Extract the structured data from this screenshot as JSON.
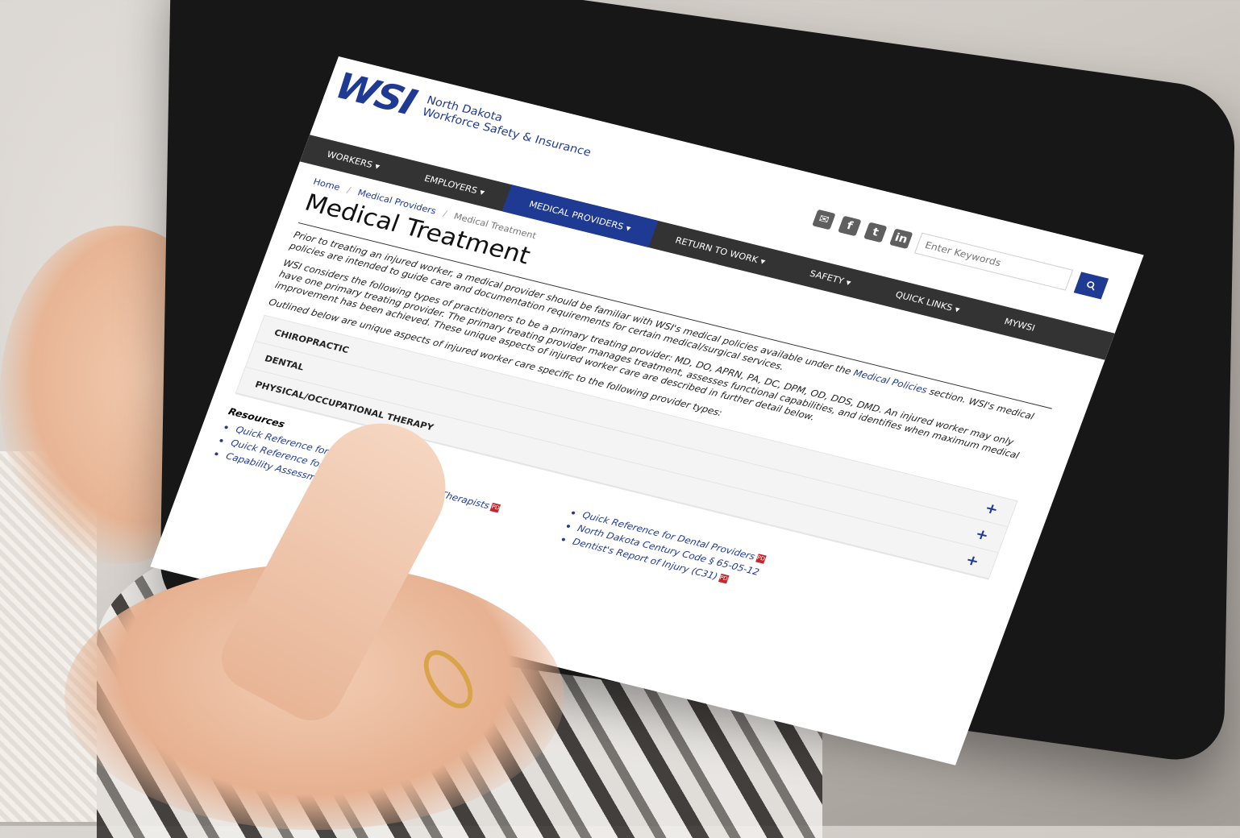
{
  "header": {
    "logo": "WSI",
    "brand_line1": "North Dakota",
    "brand_line2": "Workforce Safety & Insurance"
  },
  "nav": {
    "items": [
      {
        "label": "WORKERS ▾"
      },
      {
        "label": "EMPLOYERS ▾"
      },
      {
        "label": "MEDICAL PROVIDERS ▾"
      },
      {
        "label": "RETURN TO WORK ▾"
      },
      {
        "label": "SAFETY ▾"
      },
      {
        "label": "QUICK LINKS ▾"
      },
      {
        "label": "MYWSI"
      }
    ]
  },
  "search": {
    "placeholder": "Enter Keywords"
  },
  "social": {
    "email_glyph": "✉",
    "facebook_glyph": "f",
    "twitter_glyph": "t",
    "linkedin_glyph": "in"
  },
  "breadcrumb": {
    "home": "Home",
    "section": "Medical Providers",
    "current": "Medical Treatment"
  },
  "page": {
    "title": "Medical Treatment",
    "p1_a": "Prior to treating an injured worker, a medical provider should be familiar with WSI's medical policies available under the",
    "p1_link": "Medical Policies",
    "p1_b": "section. WSI's medical policies are intended to guide care and documentation requirements for certain medical/surgical services.",
    "p2": "WSI considers the following types of practitioners to be a primary treating provider: MD, DO, APRN, PA, DC, DPM, OD, DDS, DMD. An injured worker may only have one primary treating provider. The primary treating provider manages treatment, assesses functional capabilities, and identifies when maximum medical improvement has been achieved. These unique aspects of injured worker care are described in further detail below.",
    "p3": "Outlined below are unique aspects of injured worker care specific to the following provider types:"
  },
  "accordion": [
    {
      "label": "CHIROPRACTIC",
      "toggle": "+"
    },
    {
      "label": "DENTAL",
      "toggle": "+"
    },
    {
      "label": "PHYSICAL/OCCUPATIONAL THERAPY",
      "toggle": "+"
    }
  ],
  "resources": {
    "title": "Resources",
    "left": [
      "Quick Reference for Chiropractors",
      "Quick Reference for Physical & Occupational Therapists",
      "Capability Assessment Form (C-5)"
    ],
    "right": [
      "Quick Reference for Dental Providers",
      "North Dakota Century Code § 65-05-12",
      "Dentist's Report of Injury (C31)"
    ],
    "pdf_label": "PDF"
  }
}
